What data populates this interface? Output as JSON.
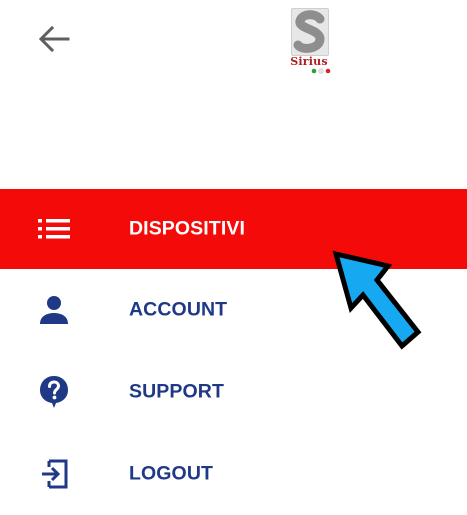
{
  "header": {
    "logo_text": "Sirius"
  },
  "menu": {
    "items": [
      {
        "label": "DISPOSITIVI",
        "icon": "list-icon",
        "active": true
      },
      {
        "label": "ACCOUNT",
        "icon": "person-icon",
        "active": false
      },
      {
        "label": "SUPPORT",
        "icon": "help-bubble-icon",
        "active": false
      },
      {
        "label": "LOGOUT",
        "icon": "logout-icon",
        "active": false
      }
    ]
  },
  "colors": {
    "active_bg": "#f50a0a",
    "label_color": "#1f3987",
    "arrow_fill": "#16a9f2"
  }
}
